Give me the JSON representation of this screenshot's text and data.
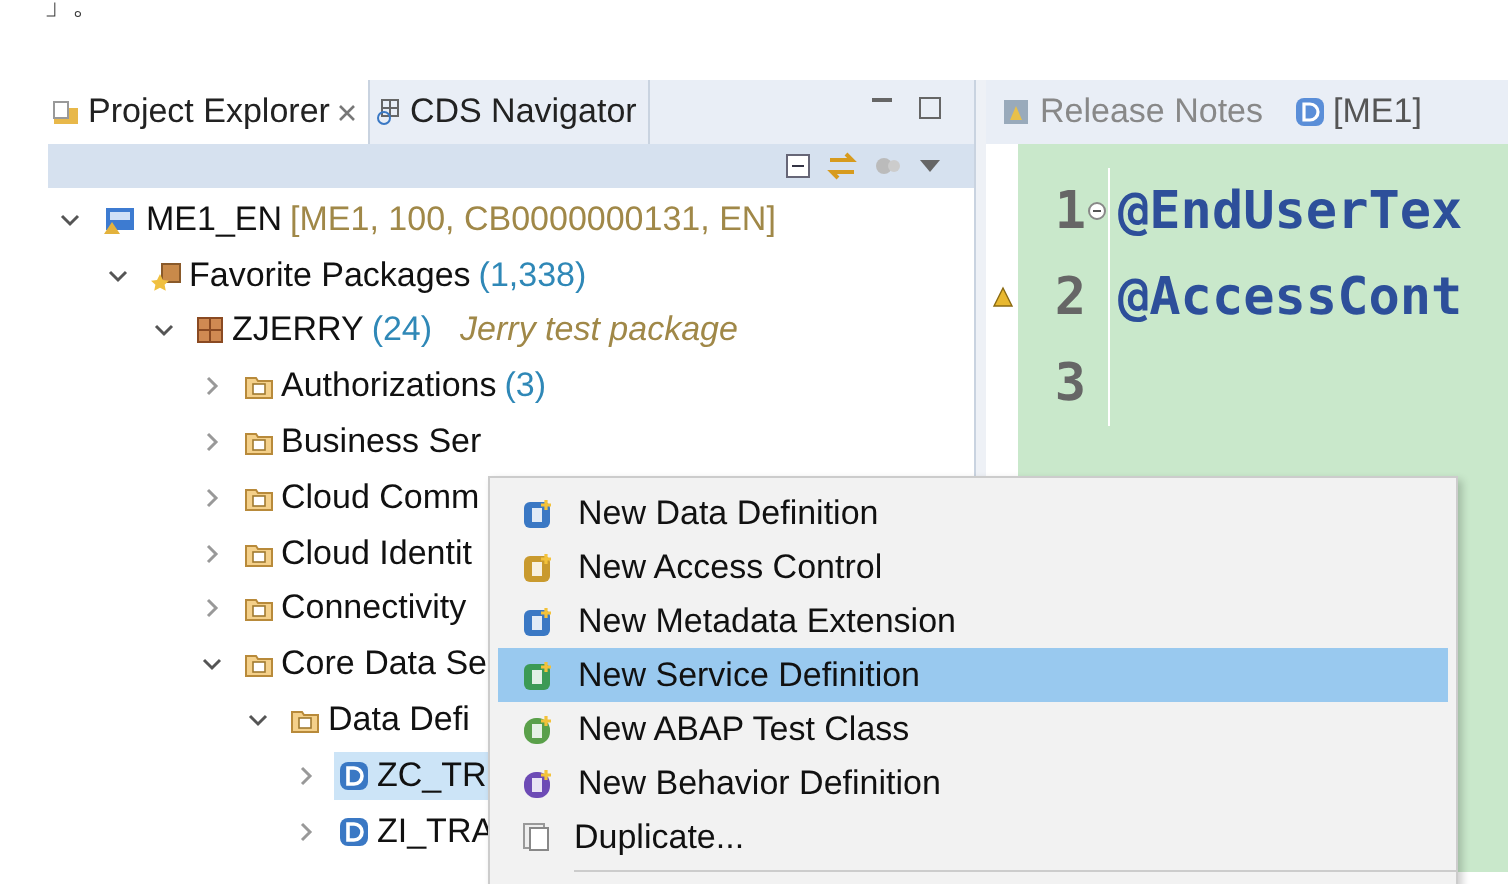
{
  "top_text": "」。",
  "explorer": {
    "tabs": [
      {
        "label": "Project Explorer",
        "selected": true
      },
      {
        "label": "CDS Navigator",
        "selected": false
      }
    ],
    "tree": [
      {
        "label": "ME1_EN",
        "detail": "[ME1, 100, CB0000000131, EN]",
        "kind": "system",
        "expanded": true,
        "selected": false,
        "children": [
          {
            "label": "Favorite Packages",
            "count": "(1,338)",
            "kind": "favorites",
            "expanded": true,
            "selected": false,
            "children": [
              {
                "label": "ZJERRY",
                "count": "(24)",
                "note": "Jerry test package",
                "kind": "package",
                "expanded": true,
                "selected": false,
                "children": [
                  {
                    "label": "Authorizations",
                    "count": "(3)",
                    "kind": "group",
                    "expanded": false,
                    "selected": false
                  },
                  {
                    "label": "Business Ser",
                    "kind": "group",
                    "expanded": false,
                    "selected": false
                  },
                  {
                    "label": "Cloud Comm",
                    "kind": "group",
                    "expanded": false,
                    "selected": false
                  },
                  {
                    "label": "Cloud Identit",
                    "kind": "group",
                    "expanded": false,
                    "selected": false
                  },
                  {
                    "label": "Connectivity",
                    "kind": "group",
                    "expanded": false,
                    "selected": false
                  },
                  {
                    "label": "Core Data Se",
                    "kind": "group",
                    "expanded": true,
                    "selected": false,
                    "children": [
                      {
                        "label": "Data Defi",
                        "kind": "type",
                        "expanded": true,
                        "selected": false,
                        "children": [
                          {
                            "label": "ZC_TR",
                            "kind": "ddl",
                            "expanded": false,
                            "selected": true
                          },
                          {
                            "label": "ZI_TRA",
                            "kind": "ddl",
                            "expanded": false,
                            "selected": false
                          }
                        ]
                      }
                    ]
                  }
                ]
              }
            ]
          }
        ]
      }
    ]
  },
  "editor": {
    "tabs": [
      {
        "label": "Release Notes",
        "kind": "notes",
        "selected": false
      },
      {
        "label": "[ME1]",
        "kind": "ddl",
        "selected": true
      }
    ],
    "lines": [
      {
        "number": "1",
        "text": "@EndUserTex",
        "folding": true,
        "warning": false
      },
      {
        "number": "2",
        "text": "@AccessCont",
        "folding": false,
        "warning": true
      },
      {
        "number": "3",
        "folding": false,
        "warning": false
      }
    ]
  },
  "context_menu": [
    {
      "label": "New Data Definition",
      "kind": "ddl",
      "selected": false
    },
    {
      "label": "New Access Control",
      "kind": "access",
      "selected": false
    },
    {
      "label": "New Metadata Extension",
      "kind": "ext",
      "selected": false
    },
    {
      "label": "New Service Definition",
      "kind": "service",
      "selected": true
    },
    {
      "label": "New ABAP Test Class",
      "kind": "test",
      "selected": false
    },
    {
      "label": "New Behavior Definition",
      "kind": "behavior",
      "selected": false
    },
    {
      "label": "Duplicate...",
      "kind": "duplicate",
      "selected": false
    }
  ]
}
